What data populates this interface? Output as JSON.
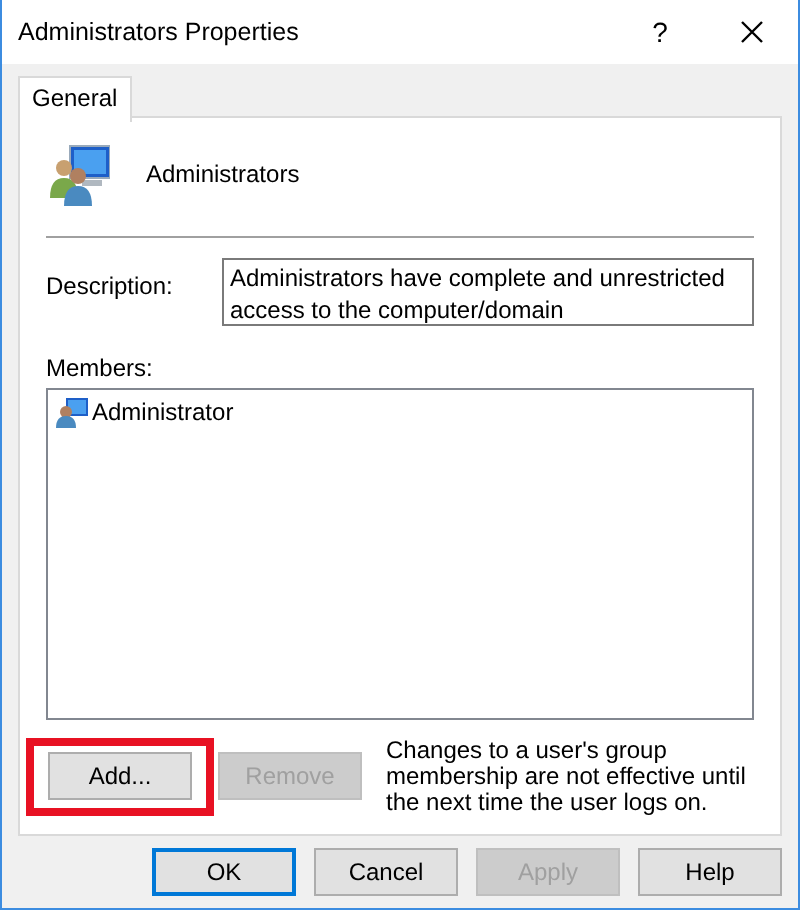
{
  "window": {
    "title": "Administrators Properties",
    "help_button": "?"
  },
  "tabs": [
    {
      "label": "General",
      "selected": true
    }
  ],
  "group": {
    "name": "Administrators"
  },
  "description": {
    "label": "Description:",
    "value": "Administrators have complete and unrestricted access to the computer/domain"
  },
  "members": {
    "label": "Members:",
    "items": [
      {
        "name": "Administrator",
        "selected": false
      }
    ]
  },
  "member_buttons": [
    {
      "label": "Add...",
      "disabled": false,
      "highlighted": true
    },
    {
      "label": "Remove",
      "disabled": true,
      "highlighted": false
    }
  ],
  "note": "Changes to a user's group membership are not effective until the next time the user logs on.",
  "buttons": [
    {
      "label": "OK",
      "disabled": false,
      "default": true
    },
    {
      "label": "Cancel",
      "disabled": false,
      "default": false
    },
    {
      "label": "Apply",
      "disabled": true,
      "default": false
    },
    {
      "label": "Help",
      "disabled": false,
      "default": false
    }
  ]
}
